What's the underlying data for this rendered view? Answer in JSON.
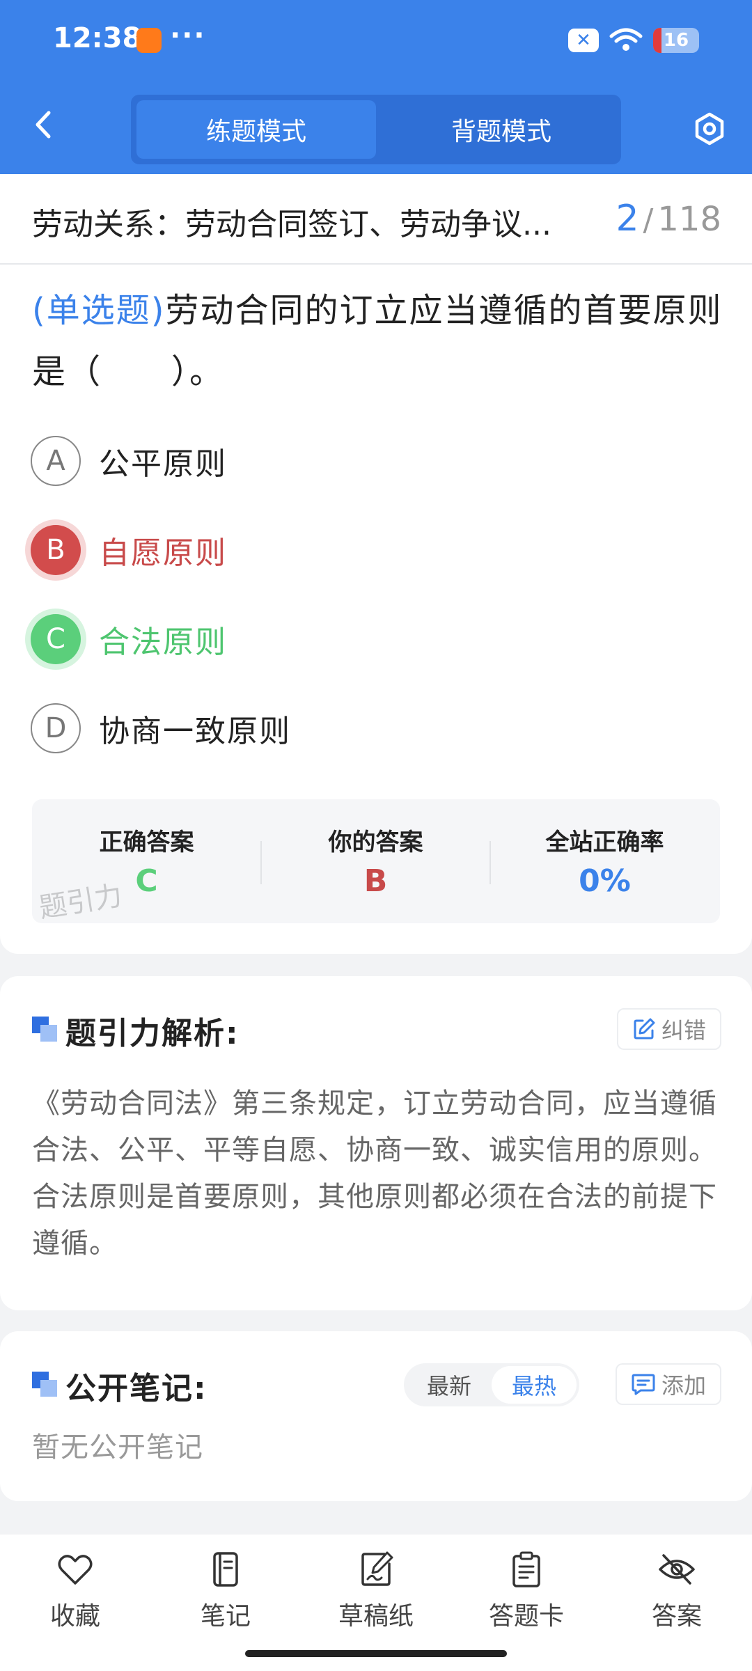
{
  "status_bar": {
    "time": "12:38",
    "dots": "···",
    "battery": "16"
  },
  "header": {
    "tabs": [
      {
        "label": "练题模式",
        "active": true
      },
      {
        "label": "背题模式",
        "active": false
      }
    ]
  },
  "question": {
    "chapter": "劳动关系：劳动合同签订、劳动争议...",
    "current": "2",
    "total": "118",
    "type_label": "(单选题)",
    "text": "劳动合同的订立应当遵循的首要原则是（　　）。",
    "options": [
      {
        "letter": "A",
        "text": "公平原则",
        "state": "normal"
      },
      {
        "letter": "B",
        "text": "自愿原则",
        "state": "wrong"
      },
      {
        "letter": "C",
        "text": "合法原则",
        "state": "correct"
      },
      {
        "letter": "D",
        "text": "协商一致原则",
        "state": "normal"
      }
    ]
  },
  "answer_summary": {
    "correct_label": "正确答案",
    "correct_value": "C",
    "yours_label": "你的答案",
    "yours_value": "B",
    "rate_label": "全站正确率",
    "rate_value": "0%",
    "watermark": "题引力"
  },
  "analysis": {
    "title": "题引力解析:",
    "correct_button": "纠错",
    "text": "《劳动合同法》第三条规定，订立劳动合同，应当遵循合法、公平、平等自愿、协商一致、诚实信用的原则。合法原则是首要原则，其他原则都必须在合法的前提下遵循。"
  },
  "notes": {
    "title": "公开笔记:",
    "sort_options": [
      "最新",
      "最热"
    ],
    "sort_active": "最热",
    "add_button": "添加",
    "empty_text": "暂无公开笔记"
  },
  "bottom_nav": {
    "items": [
      {
        "label": "收藏",
        "icon": "heart-icon"
      },
      {
        "label": "笔记",
        "icon": "notebook-icon"
      },
      {
        "label": "草稿纸",
        "icon": "draft-icon"
      },
      {
        "label": "答题卡",
        "icon": "answer-sheet-icon"
      },
      {
        "label": "答案",
        "icon": "eye-off-icon"
      }
    ]
  },
  "colors": {
    "primary": "#3b82ea",
    "wrong": "#d24c4c",
    "correct": "#5bcf7b"
  }
}
